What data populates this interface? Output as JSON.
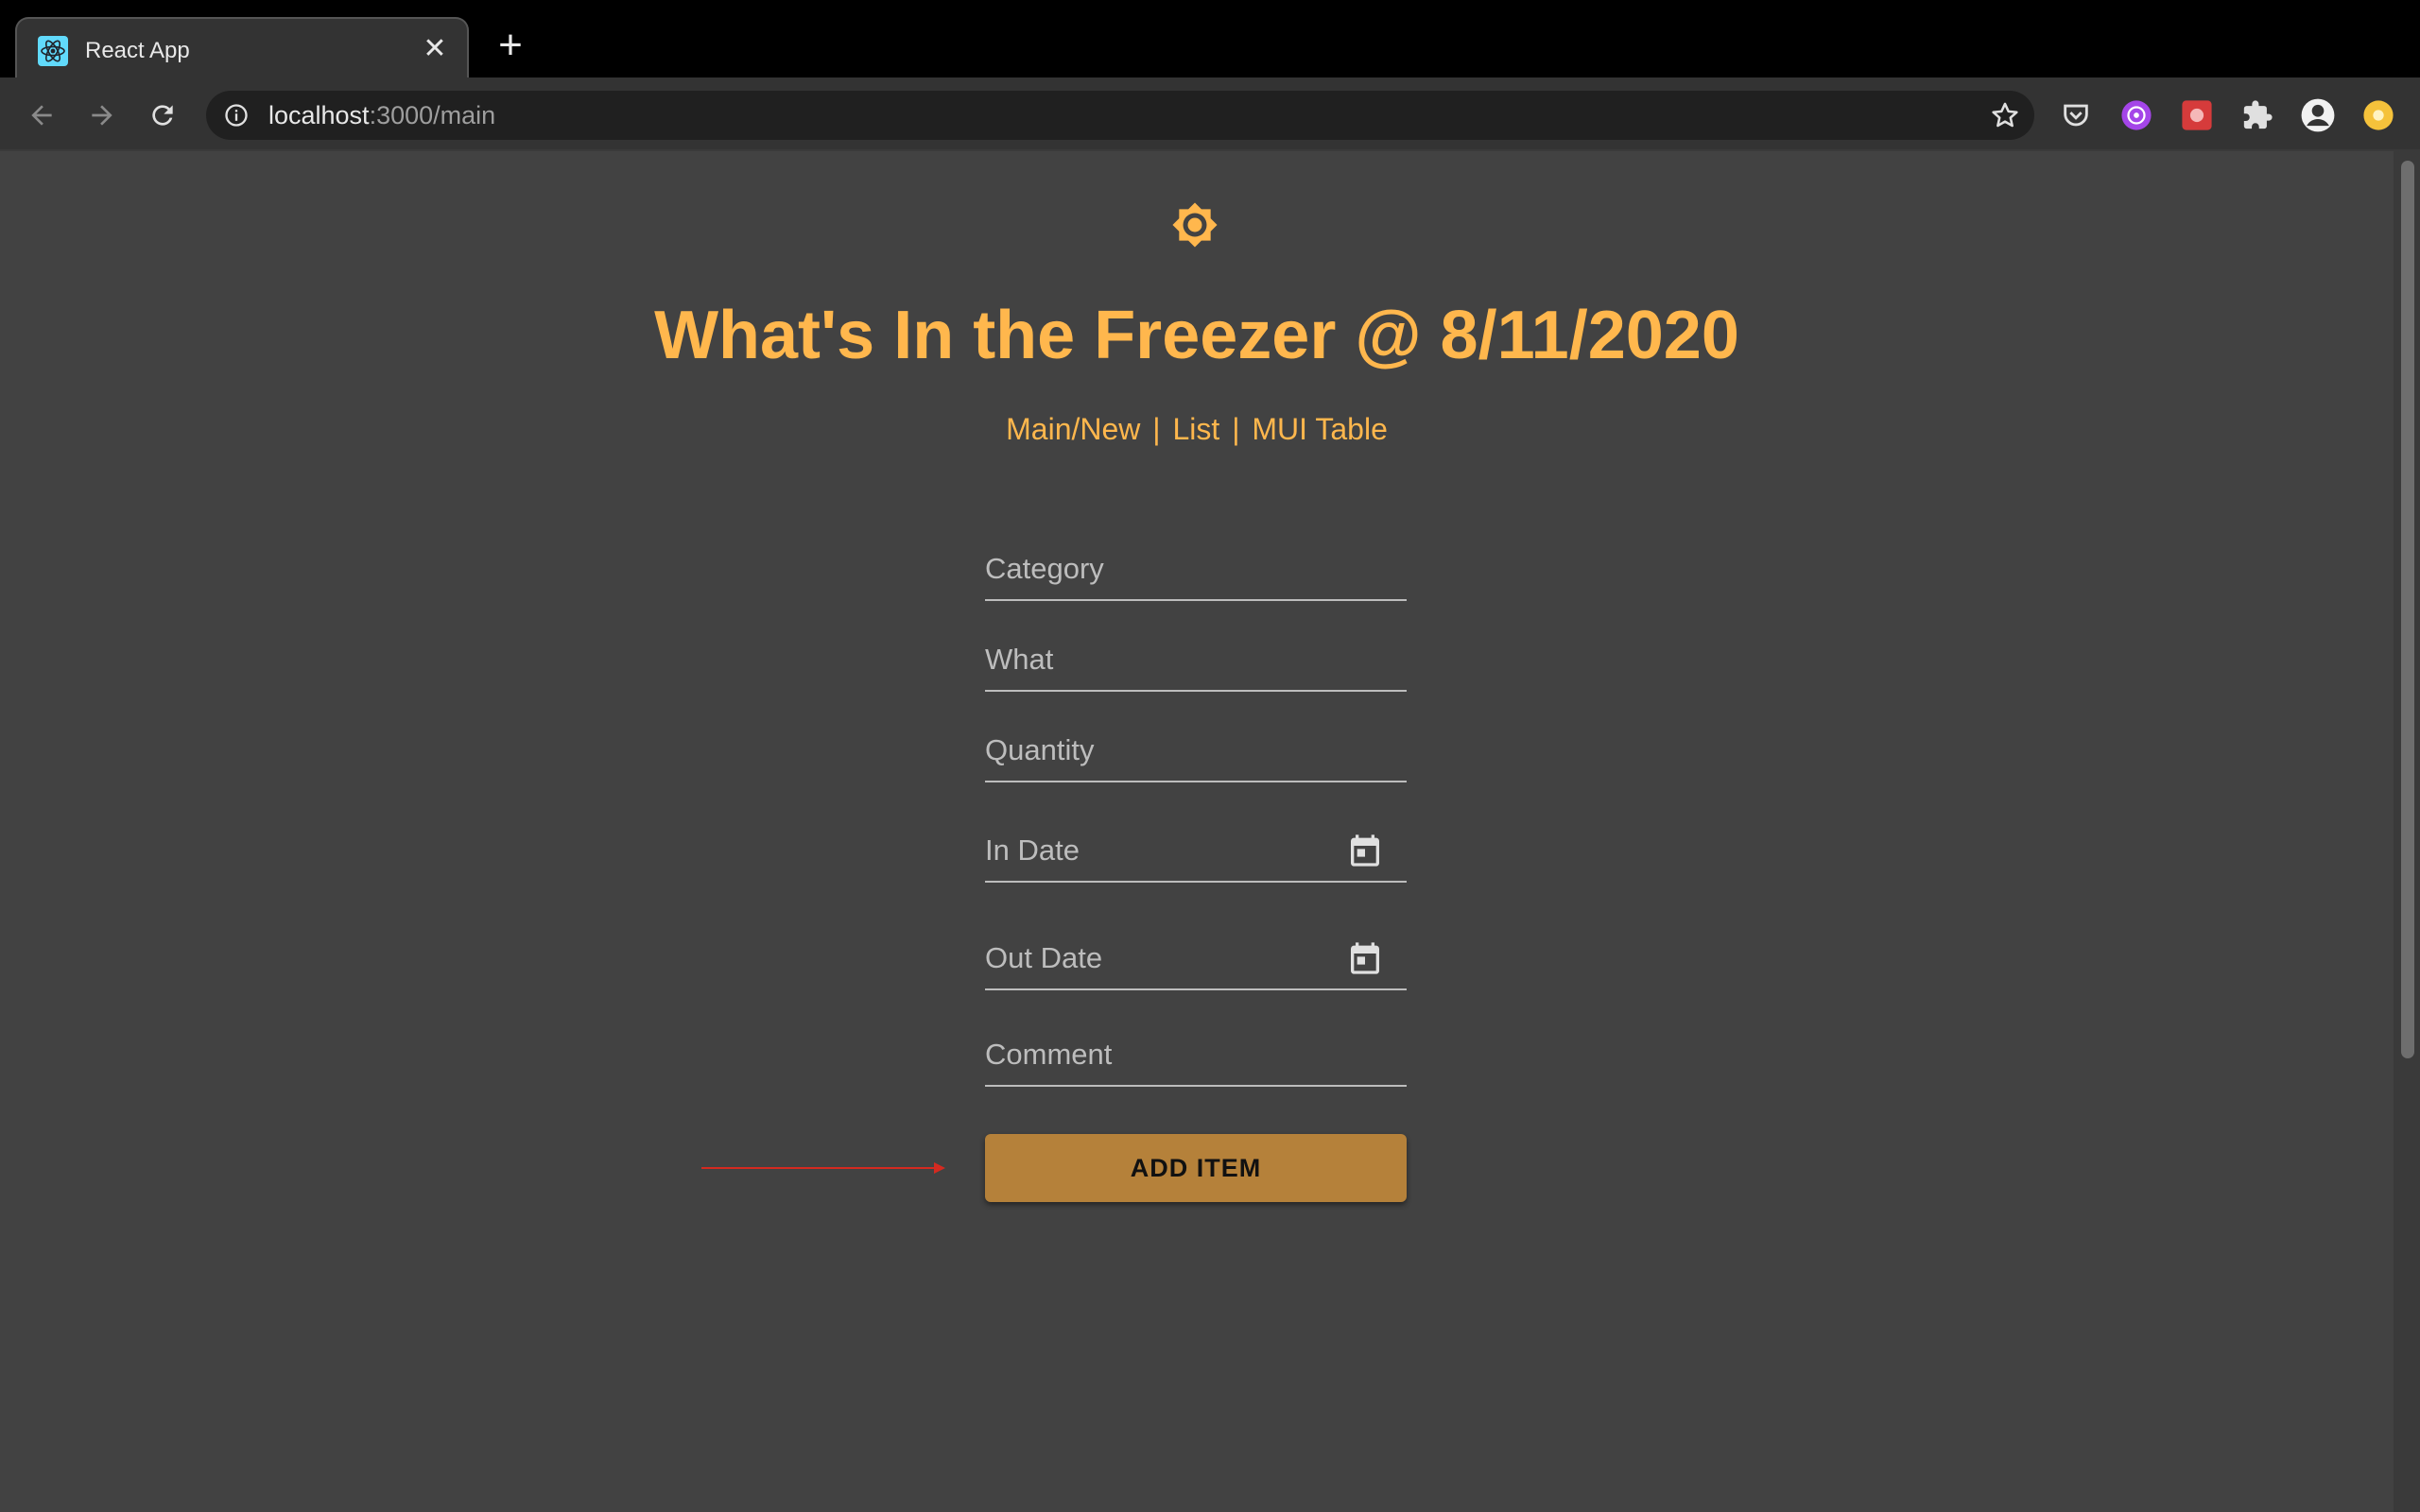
{
  "browser": {
    "tab_title": "React App",
    "url_host": "localhost",
    "url_path": ":3000/main"
  },
  "page": {
    "title": "What's In the Freezer @ 8/11/2020",
    "nav": {
      "main_new": "Main/New",
      "list": "List",
      "mui_table": "MUI Table",
      "separator": "|"
    },
    "form": {
      "category_label": "Category",
      "what_label": "What",
      "quantity_label": "Quantity",
      "in_date_label": "In Date",
      "out_date_label": "Out Date",
      "comment_label": "Comment",
      "submit_label": "ADD ITEM"
    }
  },
  "icons": {
    "theme_toggle": "sun-icon",
    "date_picker": "calendar-icon",
    "favicon": "react-logo-icon"
  },
  "colors": {
    "accent": "#ffb74d",
    "button": "#b5813a",
    "background": "#424242",
    "annotation_arrow": "#d42a20"
  }
}
